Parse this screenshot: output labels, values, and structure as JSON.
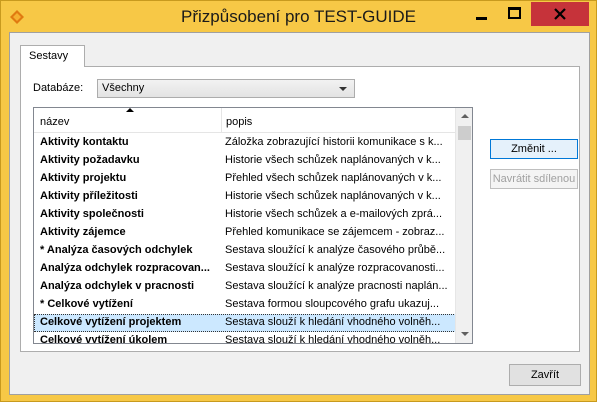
{
  "window": {
    "title": "Přizpůsobení pro TEST-GUIDE",
    "icon": "app-icon"
  },
  "tabs": [
    {
      "label": "Sestavy",
      "active": true
    }
  ],
  "database": {
    "label": "Databáze:",
    "selected": "Všechny"
  },
  "list": {
    "columns": {
      "name": "název",
      "description": "popis"
    },
    "sort": {
      "column": "name",
      "direction": "ascending"
    },
    "rows": [
      {
        "name": "Aktivity kontaktu",
        "description": "Záložka zobrazující historii komunikace s k..."
      },
      {
        "name": "Aktivity požadavku",
        "description": "Historie všech schůzek naplánovaných v k..."
      },
      {
        "name": "Aktivity projektu",
        "description": "Přehled všech schůzek naplánovaných v k..."
      },
      {
        "name": "Aktivity příležitosti",
        "description": "Historie všech schůzek naplánovaných v k..."
      },
      {
        "name": "Aktivity společnosti",
        "description": "Historie všech schůzek a e-mailových zprá..."
      },
      {
        "name": "Aktivity zájemce",
        "description": "Přehled komunikace se zájemcem - zobraz..."
      },
      {
        "name": "* Analýza časových odchylek",
        "description": "Sestava sloužící k analýze časového průbě..."
      },
      {
        "name": "Analýza odchylek rozpracovan...",
        "description": "Sestava sloužící k analýze rozpracovanosti..."
      },
      {
        "name": "Analýza odchylek v pracnosti",
        "description": "Sestava sloužící k analýze pracnosti naplán..."
      },
      {
        "name": "* Celkové vytížení",
        "description": "Sestava formou sloupcového grafu ukazuj..."
      },
      {
        "name": "Celkové vytížení projektem",
        "description": "Sestava slouží k hledání vhodného volněh...",
        "selected": true
      },
      {
        "name": "Celkové vytížení úkolem",
        "description": "Sestava slouží k hledání vhodného volněh..."
      }
    ]
  },
  "buttons": {
    "change": "Změnit ...",
    "restore": "Navrátit sdílenou",
    "close": "Zavřít"
  },
  "colors": {
    "titlebar": "#f7c846",
    "close_button": "#c6333a",
    "selection": "#cce8ff"
  }
}
